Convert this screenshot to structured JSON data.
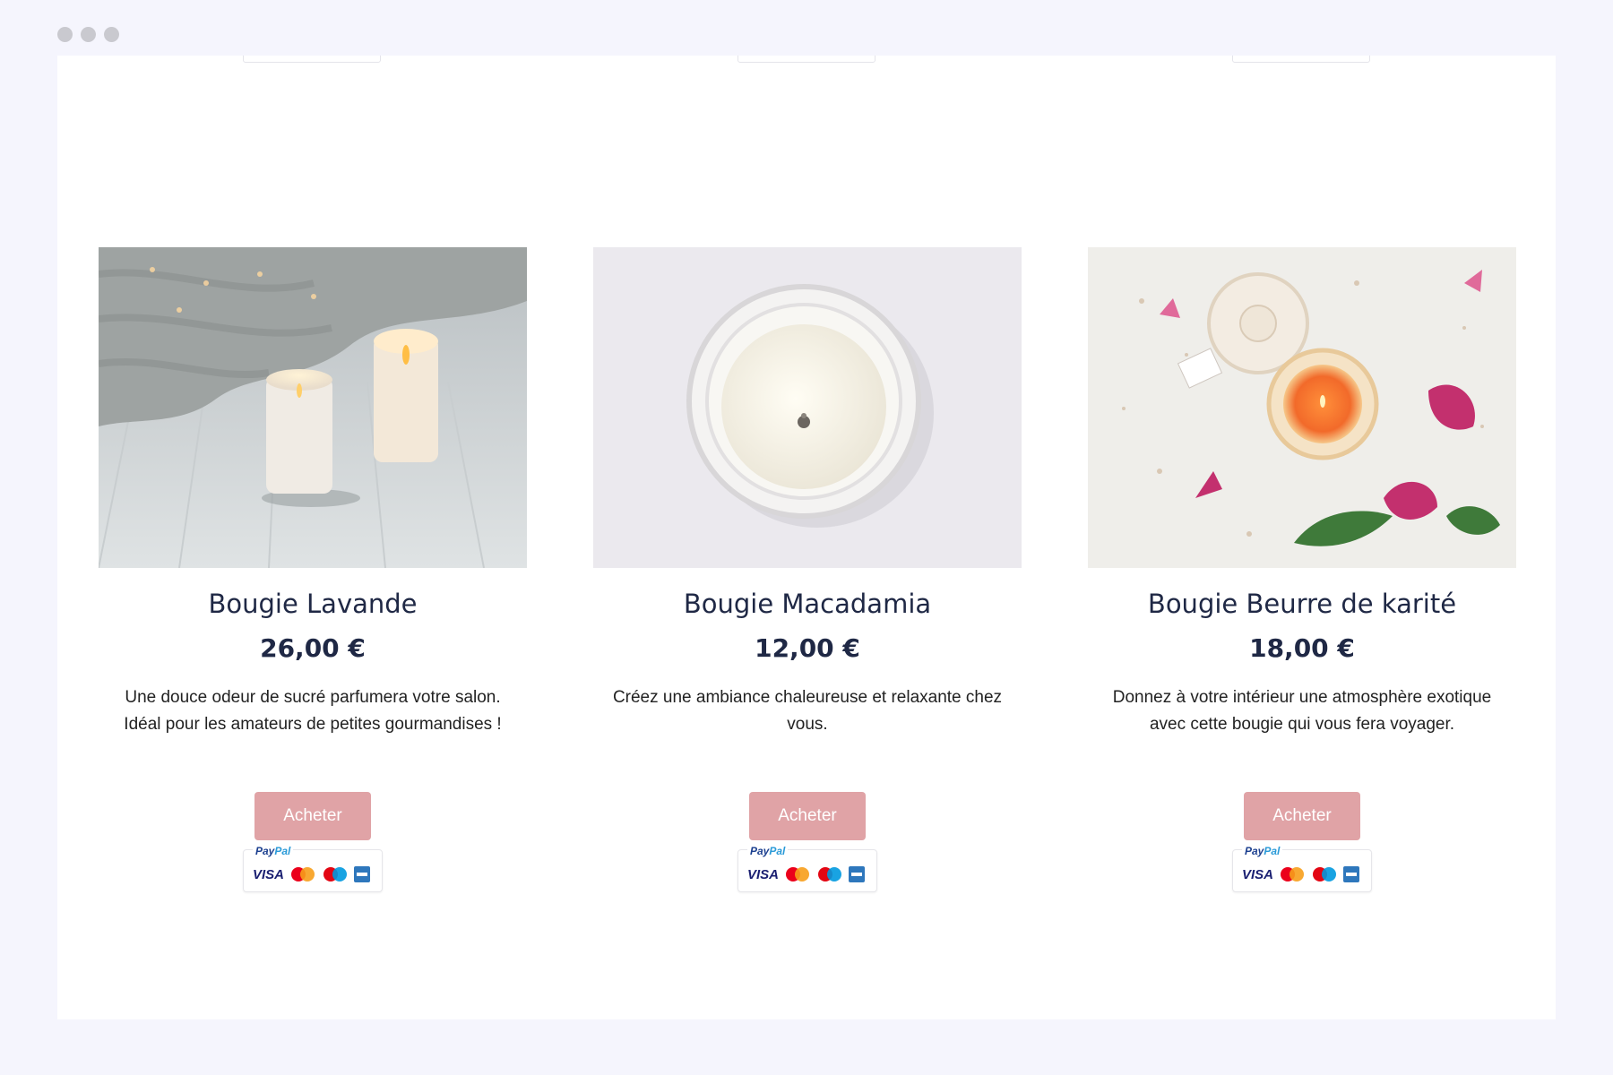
{
  "products": [
    {
      "title": "Bougie Lavande",
      "price": "26,00 €",
      "description": "Une douce odeur de sucré parfumera votre salon. Idéal pour les amateurs de petites gourmandises !",
      "buy_label": "Acheter"
    },
    {
      "title": "Bougie Macadamia",
      "price": "12,00 €",
      "description": "Créez une ambiance chaleureuse et relaxante chez vous.",
      "buy_label": "Acheter"
    },
    {
      "title": "Bougie Beurre de karité",
      "price": "18,00 €",
      "description": "Donnez à votre intérieur une atmosphère exotique avec cette bougie qui vous fera voyager.",
      "buy_label": "Acheter"
    }
  ],
  "payment": {
    "paypal_prefix": "Pay",
    "paypal_suffix": "Pal",
    "visa": "VISA"
  },
  "colors": {
    "accent": "#e0a3a6",
    "text": "#1f2845",
    "background": "#f5f5fd"
  }
}
